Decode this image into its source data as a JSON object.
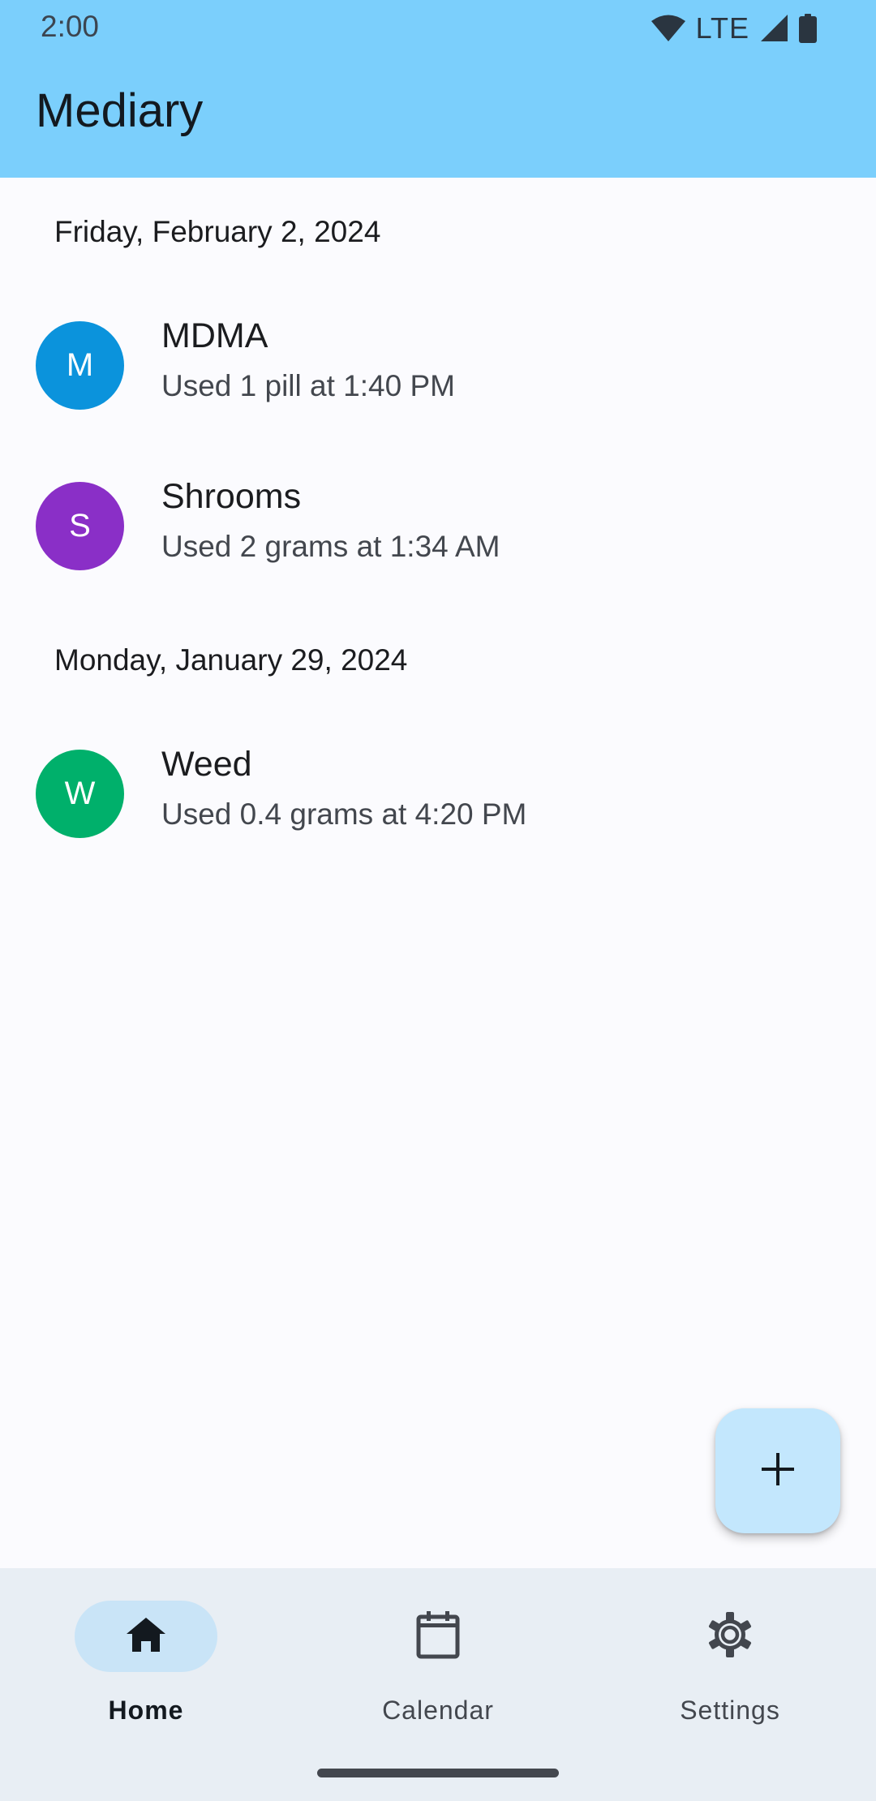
{
  "status_bar": {
    "time": "2:00",
    "network": "LTE",
    "icons": [
      "wifi-icon",
      "cell-signal-icon",
      "battery-icon"
    ]
  },
  "app_bar": {
    "title": "Mediary",
    "color": "#7bcffc"
  },
  "sections": [
    {
      "date": "Friday, February 2, 2024",
      "entries": [
        {
          "initial": "M",
          "name": "MDMA",
          "detail": "Used 1 pill at 1:40 PM",
          "color": "#0b93dc"
        },
        {
          "initial": "S",
          "name": "Shrooms",
          "detail": "Used 2 grams at 1:34 AM",
          "color": "#8a2fc7"
        }
      ]
    },
    {
      "date": "Monday, January 29, 2024",
      "entries": [
        {
          "initial": "W",
          "name": "Weed",
          "detail": "Used 0.4 grams at 4:20 PM",
          "color": "#00b06b"
        }
      ]
    }
  ],
  "fab": {
    "icon": "plus-icon",
    "color": "#c3e7fd"
  },
  "bottom_nav": {
    "items": [
      {
        "label": "Home",
        "icon": "home-icon",
        "active": true
      },
      {
        "label": "Calendar",
        "icon": "calendar-icon",
        "active": false
      },
      {
        "label": "Settings",
        "icon": "gear-icon",
        "active": false
      }
    ]
  }
}
